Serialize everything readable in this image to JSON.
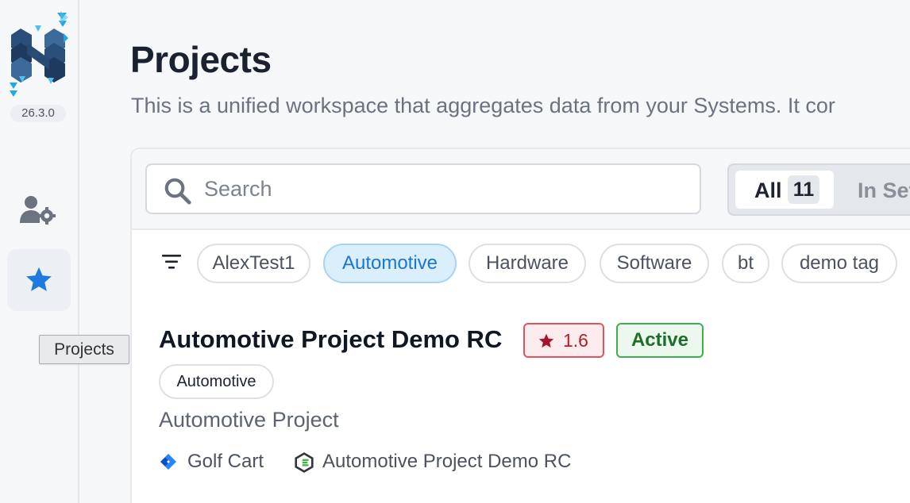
{
  "sidebar": {
    "version": "26.3.0",
    "tooltip": "Projects",
    "items": [
      {
        "icon": "user-settings-icon"
      },
      {
        "icon": "star-icon",
        "active": true
      }
    ]
  },
  "page": {
    "title": "Projects",
    "description": "This is a unified workspace that aggregates data from your Systems. It cor"
  },
  "toolbar": {
    "search_placeholder": "Search",
    "segments": {
      "all_label": "All",
      "all_count": "11",
      "inset_label": "In Set"
    }
  },
  "tags": [
    {
      "label": "AlexTest1",
      "active": false
    },
    {
      "label": "Automotive",
      "active": true
    },
    {
      "label": "Hardware",
      "active": false
    },
    {
      "label": "Software",
      "active": false
    },
    {
      "label": "bt",
      "active": false
    },
    {
      "label": "demo tag",
      "active": false
    }
  ],
  "project": {
    "title": "Automotive Project Demo RC",
    "rating": "1.6",
    "status": "Active",
    "tag": "Automotive",
    "description": "Automotive Project",
    "links": [
      {
        "label": "Golf Cart",
        "icon": "jira-icon"
      },
      {
        "label": "Automotive Project Demo RC",
        "icon": "codebeamer-icon"
      }
    ]
  },
  "colors": {
    "accent_blue": "#1877d6",
    "active_green": "#3fae4e",
    "rating_red": "#e8505b"
  }
}
